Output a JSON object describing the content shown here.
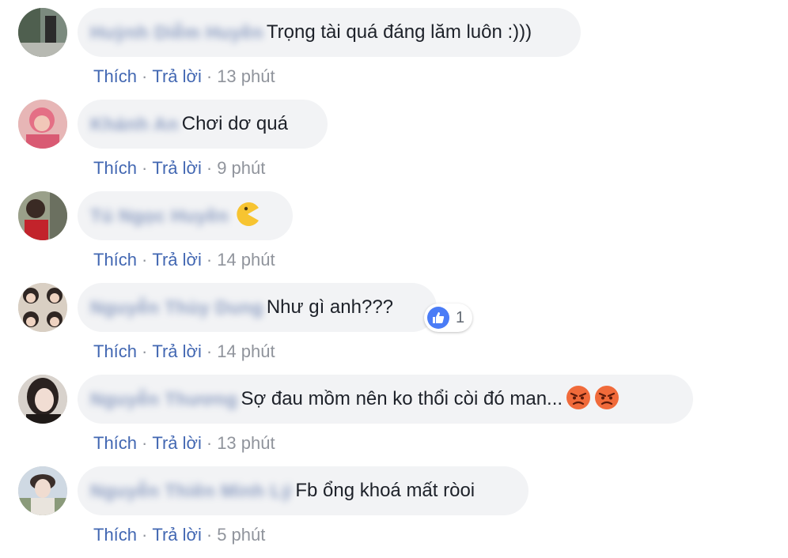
{
  "comments": [
    {
      "author": "Huỳnh Diễm Huyền",
      "text": "Trọng tài quá đáng lăm luôn :)))",
      "like": "Thích",
      "reply": "Trả lời",
      "time": "13 phút"
    },
    {
      "author": "Khánh An",
      "text": "Chơi dơ quá",
      "like": "Thích",
      "reply": "Trả lời",
      "time": "9 phút"
    },
    {
      "author": "Tú Ngọc Huyền",
      "text": "",
      "emoji": "pacman-face-emoji",
      "like": "Thích",
      "reply": "Trả lời",
      "time": "14 phút"
    },
    {
      "author": "Nguyễn Thùy Dung",
      "text": "Như gì anh???",
      "like": "Thích",
      "reply": "Trả lời",
      "time": "14 phút",
      "reaction_count": "1",
      "reaction_icon": "like-icon"
    },
    {
      "author": "Nguyễn Thương",
      "text": "Sợ đau mồm nên ko thổi còi đó man...",
      "emoji": "angry-face-emoji",
      "like": "Thích",
      "reply": "Trả lời",
      "time": "13 phút"
    },
    {
      "author": "Nguyễn Thiên Minh Lý",
      "text": "Fb ổng khoá mất ròoi",
      "like": "Thích",
      "reply": "Trả lời",
      "time": "5 phút"
    }
  ],
  "colors": {
    "link": "#4267b2",
    "bubble": "#f2f3f5",
    "meta": "#90949c",
    "like_badge": "#4a7cf6",
    "angry": "#f06a3a"
  }
}
